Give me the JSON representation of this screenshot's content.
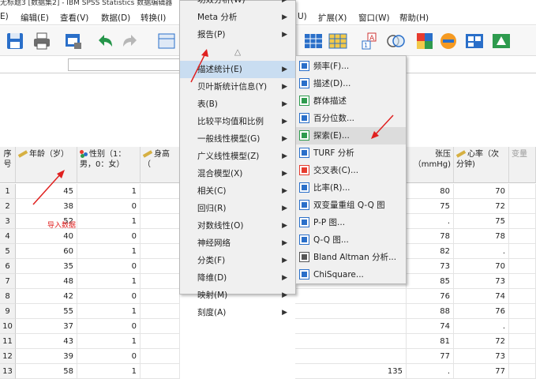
{
  "window": {
    "title": "无标题3 [数据集2] - IBM SPSS Statistics 数据编辑器"
  },
  "menubar": {
    "left_items": [
      "E)",
      "编辑(E)",
      "查看(V)",
      "数据(D)",
      "转换(I)"
    ],
    "right_items": [
      "U)",
      "扩展(X)",
      "窗口(W)",
      "帮助(H)"
    ]
  },
  "columns": [
    {
      "label": "序号",
      "kind": "none"
    },
    {
      "label": "年龄（岁）",
      "kind": "scale"
    },
    {
      "label": "性别（1：男，0：女）",
      "kind": "nominal"
    },
    {
      "label": "身高（",
      "kind": "scale"
    },
    {
      "label": "张压（mmHg)",
      "kind": "scale"
    },
    {
      "label": "心率（次分钟)",
      "kind": "scale"
    },
    {
      "label": "变量",
      "kind": "none"
    }
  ],
  "rows": [
    {
      "no": "1",
      "age": "45",
      "sex": "1",
      "col8": "",
      "bp": "80",
      "hr": "70"
    },
    {
      "no": "2",
      "age": "38",
      "sex": "0",
      "col8": "",
      "bp": "75",
      "hr": "72"
    },
    {
      "no": "3",
      "age": "52",
      "sex": "1",
      "col8": "",
      "bp": ".",
      "hr": "75"
    },
    {
      "no": "4",
      "age": "40",
      "sex": "0",
      "col8": "",
      "bp": "78",
      "hr": "78"
    },
    {
      "no": "5",
      "age": "60",
      "sex": "1",
      "col8": "",
      "bp": "82",
      "hr": "."
    },
    {
      "no": "6",
      "age": "35",
      "sex": "0",
      "col8": "",
      "bp": "73",
      "hr": "70"
    },
    {
      "no": "7",
      "age": "48",
      "sex": "1",
      "col8": "",
      "bp": "85",
      "hr": "73"
    },
    {
      "no": "8",
      "age": "42",
      "sex": "0",
      "col8": "",
      "bp": "76",
      "hr": "74"
    },
    {
      "no": "9",
      "age": "55",
      "sex": "1",
      "col8": "",
      "bp": "88",
      "hr": "76"
    },
    {
      "no": "10",
      "age": "37",
      "sex": "0",
      "col8": "",
      "bp": "74",
      "hr": "."
    },
    {
      "no": "11",
      "age": "43",
      "sex": "1",
      "col8": "",
      "bp": "81",
      "hr": "72"
    },
    {
      "no": "12",
      "age": "39",
      "sex": "0",
      "col8": "",
      "bp": "77",
      "hr": "73"
    },
    {
      "no": "13",
      "age": "58",
      "sex": "1",
      "col8": "135",
      "bp": ".",
      "hr": "77"
    }
  ],
  "annotation": {
    "text": "导入数据",
    "color": "#e0201f"
  },
  "menu1": {
    "top_cut_item": "功效分析(W)",
    "items": [
      {
        "label": "Meta 分析",
        "submenu": true
      },
      {
        "label": "报告(P)",
        "submenu": true
      },
      {
        "label": "△",
        "submenu": false
      },
      {
        "label": "描述统计(E)",
        "submenu": true,
        "highlighted": true
      },
      {
        "label": "贝叶斯统计信息(Y)",
        "submenu": true
      },
      {
        "label": "表(B)",
        "submenu": true
      },
      {
        "label": "比较平均值和比例",
        "submenu": true
      },
      {
        "label": "一般线性模型(G)",
        "submenu": true
      },
      {
        "label": "广义线性模型(Z)",
        "submenu": true
      },
      {
        "label": "混合模型(X)",
        "submenu": true
      },
      {
        "label": "相关(C)",
        "submenu": true
      },
      {
        "label": "回归(R)",
        "submenu": true
      },
      {
        "label": "对数线性(O)",
        "submenu": true
      },
      {
        "label": "神经网络",
        "submenu": true
      },
      {
        "label": "分类(F)",
        "submenu": true
      },
      {
        "label": "降维(D)",
        "submenu": true
      },
      {
        "label": "映射(M)",
        "submenu": true
      },
      {
        "label": "刻度(A)",
        "submenu": true
      }
    ]
  },
  "menu2": {
    "items": [
      {
        "label": "频率(F)...",
        "icon": "frequencies-icon"
      },
      {
        "label": "描述(D)...",
        "icon": "descriptives-icon"
      },
      {
        "label": "群体描述",
        "icon": "group-description-icon"
      },
      {
        "label": "百分位数...",
        "icon": "percentiles-icon"
      },
      {
        "label": "探索(E)...",
        "icon": "explore-icon",
        "highlighted": true
      },
      {
        "label": "TURF 分析",
        "icon": "turf-icon"
      },
      {
        "label": "交叉表(C)...",
        "icon": "crosstabs-icon"
      },
      {
        "label": "比率(R)...",
        "icon": "ratio-icon"
      },
      {
        "label": "双变量重组 Q-Q 图",
        "icon": "bivariate-qq-icon"
      },
      {
        "label": "P-P 图...",
        "icon": "pp-plot-icon"
      },
      {
        "label": "Q-Q 图...",
        "icon": "qq-plot-icon"
      },
      {
        "label": "Bland Altman 分析...",
        "icon": "bland-altman-icon"
      },
      {
        "label": "ChiSquare...",
        "icon": "chisquare-icon"
      }
    ]
  },
  "colors": {
    "highlight": "#c9ddf1",
    "arrow": "#e0201f"
  }
}
